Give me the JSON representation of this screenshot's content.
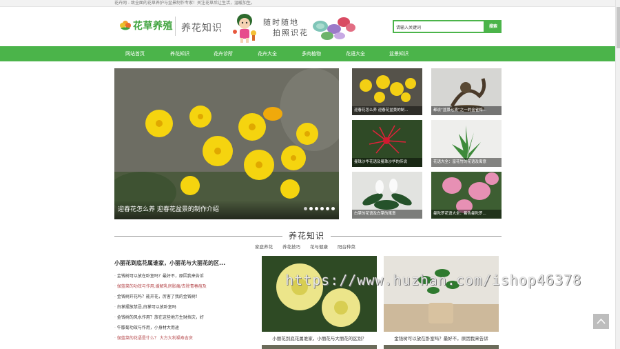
{
  "topbar": {
    "text": "花卉网 - 致全面的花草养护与盆景制作专家！关注花草后让生活，温暖加生。"
  },
  "header": {
    "logo_text": "花草养殖",
    "subtitle": "养花知识",
    "slogan_line1": "随时随地",
    "slogan_line2": "拍照识花"
  },
  "search": {
    "value": "请输入关键词",
    "button": "搜索"
  },
  "nav": [
    "网站首页",
    "养花知识",
    "花卉诊所",
    "花卉大全",
    "多肉植物",
    "花语大全",
    "盆景知识"
  ],
  "slider": {
    "caption": "迎春花怎么养 迎春花盆景的制作介绍",
    "slides": 6,
    "active": 1
  },
  "thumbs": [
    "迎春花怎么养 迎春花盆景的制...",
    "都说“盆景七贤”之一的金雀梅...",
    "曼珠沙华花语及曼珠沙华的传说",
    "花语大全：富花竹的花语及寓意",
    "白掌的花语及白掌的寓意",
    "曼陀罗花语大全：着色曼陀罗..."
  ],
  "section": {
    "title": "养花知识",
    "tabs": [
      "家庭养花",
      "养花技巧",
      "花与健康",
      "阳台种菜"
    ]
  },
  "list": {
    "title": "小丽花到底花属谁家，小丽花与大丽花的区...",
    "items": [
      "金钱树可以放在卧室吗？最好不，原因我来告诉",
      "伽蓝菜的功效与作用,缓解乳房胀痛/去除青春痘及",
      "金钱树开花吗？能开花，厉害了我的金钱树！",
      "白掌摆放禁忌,白掌可以放卧室吗",
      "金钱树的风水作用？放在这些地方生财挡灾，好",
      "牛膝菊功效与作用，小身材大用途",
      "伽蓝菜的花语是什么？ 大方大利福寿吉庆"
    ]
  },
  "cards": [
    "小丽花到底花属谁家，小丽花与大丽花的区别？",
    "金钱树可以放在卧室吗？最好不，原因我来告诉"
  ],
  "watermark": "https://www.huzhan.com/ishop46378",
  "colors": {
    "brand_green": "#4bb44a",
    "red_text": "#b5484b"
  }
}
